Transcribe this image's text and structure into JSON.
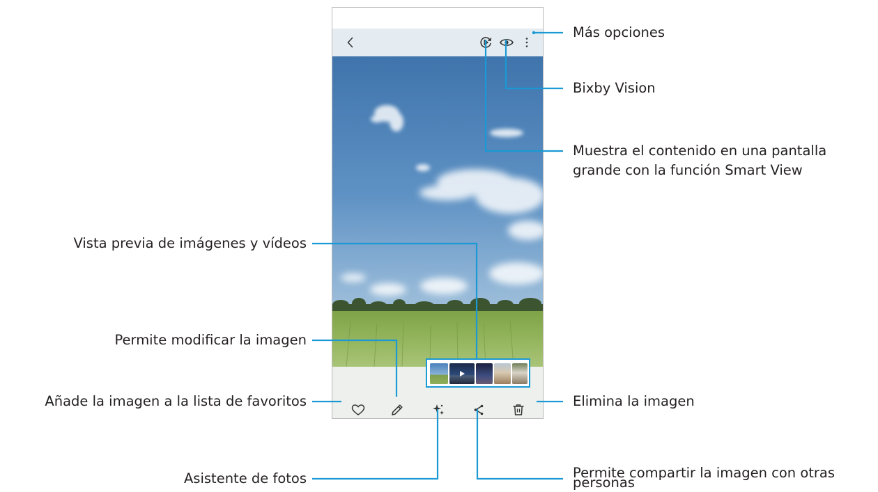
{
  "colors": {
    "callout_line": "#1a99d4",
    "text": "#231f20",
    "phone_border": "#b8b8b8",
    "sky_top": "#3f74ac",
    "grass": "#8caf55"
  },
  "icons": {
    "back": "chevron-left-icon",
    "smart_view": "smart-view-icon",
    "bixby": "eye-icon",
    "more": "more-vertical-icon",
    "favorite": "heart-icon",
    "edit": "pencil-icon",
    "assistant": "sparkle-icon",
    "share": "share-icon",
    "delete": "trash-icon"
  },
  "callouts": {
    "mas_opciones": "Más opciones",
    "bixby_vision": "Bixby Vision",
    "smart_view_line1": "Muestra el contenido en una pantalla",
    "smart_view_line2": "grande con la función Smart View",
    "preview": "Vista previa de imágenes y vídeos",
    "edit": "Permite modificar la imagen",
    "favorites": "Añade la imagen a la lista de favoritos",
    "delete": "Elimina la imagen",
    "assistant": "Asistente de fotos",
    "share_line1": "Permite compartir la imagen con otras",
    "share_line2": "personas"
  }
}
